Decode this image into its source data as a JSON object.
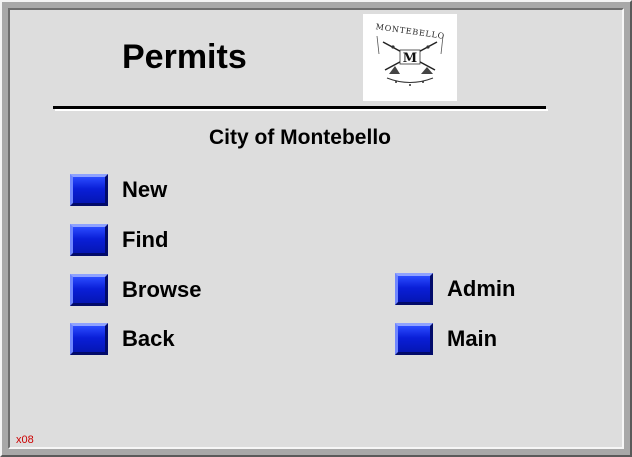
{
  "window": {
    "title": "Permits",
    "subtitle": "City of Montebello",
    "footer_code": "x08"
  },
  "seal": {
    "icon": "city-seal-icon",
    "ring_text": "MONTEBELLO",
    "center_letter": "M"
  },
  "nav": {
    "left": [
      {
        "id": "new",
        "label": "New"
      },
      {
        "id": "find",
        "label": "Find"
      },
      {
        "id": "browse",
        "label": "Browse"
      },
      {
        "id": "back",
        "label": "Back"
      }
    ],
    "right": [
      {
        "id": "admin",
        "label": "Admin"
      },
      {
        "id": "main",
        "label": "Main"
      }
    ]
  },
  "colors": {
    "panel": "#dddddd",
    "button_blue": "#0a1fd8",
    "footer_code": "#cc0000"
  }
}
